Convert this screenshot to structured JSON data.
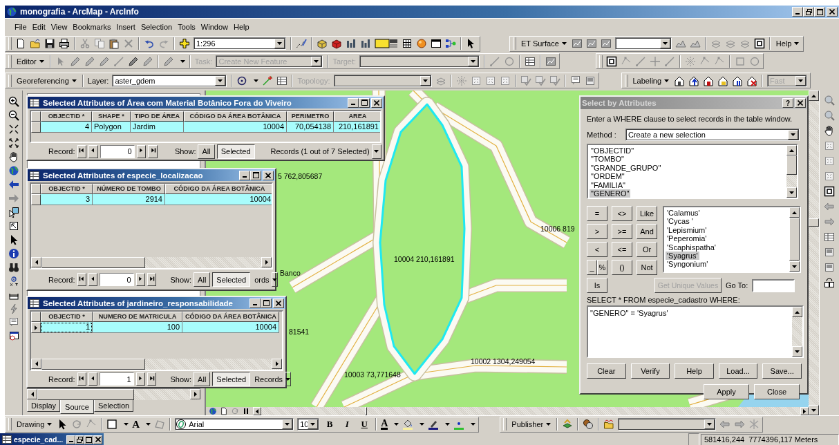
{
  "window": {
    "title": "monografia - ArcMap - ArcInfo"
  },
  "menu": [
    "File",
    "Edit",
    "View",
    "Bookmarks",
    "Insert",
    "Selection",
    "Tools",
    "Window",
    "Help"
  ],
  "standard_toolbar": {
    "scale": "1:296"
  },
  "et_toolbar": {
    "menu": "ET Surface",
    "help_menu": "Help"
  },
  "editor_toolbar": {
    "menu": "Editor",
    "task_label": "Task:",
    "task": "Create New Feature",
    "target_label": "Target:",
    "disabled": true
  },
  "georeferencing_toolbar": {
    "menu": "Georeferencing",
    "layer_label": "Layer:",
    "layer": "aster_gdem"
  },
  "topology_toolbar": {
    "label": "Topology:",
    "disabled": true
  },
  "labeling_toolbar": {
    "menu": "Labeling",
    "mode": "Fast",
    "disabled": true
  },
  "table_windows": [
    {
      "title": "Selected Attributes of Área com Material Botânico Fora do Viveiro",
      "columns": [
        "OBJECTID *",
        "SHAPE *",
        "TIPO DE ÁREA",
        "CÓDIGO DA ÁREA BOTÂNICA",
        "PERIMETRO",
        "AREA"
      ],
      "rows": [
        {
          "cells": [
            "4",
            "Polygon",
            "Jardim",
            "10004",
            "70,054138",
            "210,161891"
          ],
          "selected": true,
          "current": false
        }
      ],
      "record_label": "Record:",
      "record": "0",
      "show_label": "Show:",
      "show": [
        {
          "label": "All",
          "selected": false
        },
        {
          "label": "Selected",
          "selected": true
        }
      ],
      "records_text": "Records (1 out of 7 Selected)"
    },
    {
      "title": "Selected Attributes of especie_localizacao",
      "columns": [
        "OBJECTID *",
        "NÚMERO DE TOMBO",
        "CÓDIGO DA ÁREA BOTÂNICA"
      ],
      "rows": [
        {
          "cells": [
            "3",
            "2914",
            "10004"
          ],
          "selected": true,
          "current": false
        }
      ],
      "record_label": "Record:",
      "record": "0",
      "show_label": "Show:",
      "show": [
        {
          "label": "All",
          "selected": false
        },
        {
          "label": "Selected",
          "selected": true
        }
      ],
      "records_text": "ords"
    },
    {
      "title": "Selected Attributes of jardineiro_responsabilidade",
      "columns": [
        "OBJECTID *",
        "NUMERO DE MATRICULA",
        "CÓDIGO DA ÁREA BOTÂNICA"
      ],
      "rows": [
        {
          "cells": [
            "1",
            "100",
            "10004"
          ],
          "selected": true,
          "current": true
        }
      ],
      "record_label": "Record:",
      "record": "1",
      "show_label": "Show:",
      "show": [
        {
          "label": "All",
          "selected": false
        },
        {
          "label": "Selected",
          "selected": true
        }
      ],
      "records_text": "Records"
    }
  ],
  "toc": {
    "tabs": [
      {
        "label": "Display",
        "selected": false
      },
      {
        "label": "Source",
        "selected": true
      },
      {
        "label": "Selection",
        "selected": false
      }
    ]
  },
  "map": {
    "labels": [
      "5 762,805687",
      "Banco",
      "81541",
      "10004 210,161891",
      "10006 819",
      "10002 1304,249054",
      "10003 73,771648"
    ]
  },
  "dialog": {
    "title": "Select by Attributes",
    "help_button": "?",
    "instruction": "Enter a WHERE clause to select records in the table window.",
    "method_label": "Method :",
    "method": "Create a new selection",
    "fields": [
      {
        "label": "\"OBJECTID\"",
        "selected": false
      },
      {
        "label": "\"TOMBO\"",
        "selected": false
      },
      {
        "label": "\"GRANDE_GRUPO\"",
        "selected": false
      },
      {
        "label": "\"ORDEM\"",
        "selected": false
      },
      {
        "label": "\"FAMILIA\"",
        "selected": false
      },
      {
        "label": "\"GENERO\"",
        "selected": true
      }
    ],
    "operators": [
      "=",
      "<>",
      "Like",
      ">",
      ">=",
      "And",
      "<",
      "<=",
      "Or",
      "_",
      "%",
      "()",
      "Not",
      "Is"
    ],
    "values": [
      {
        "label": "'Calamus'",
        "selected": false
      },
      {
        "label": "'Cycas '",
        "selected": false
      },
      {
        "label": "'Lepismium'",
        "selected": false
      },
      {
        "label": "'Peperomia'",
        "selected": false
      },
      {
        "label": "'Scaphispatha'",
        "selected": false
      },
      {
        "label": "'Syagrus'",
        "selected": true
      },
      {
        "label": "'Syngonium'",
        "selected": false
      }
    ],
    "unique_values_button": {
      "label": "Get Unique Values",
      "disabled": true
    },
    "goto_label": "Go To:",
    "sql_label": "SELECT * FROM especie_cadastro WHERE:",
    "query": "\"GENERO\" = 'Syagrus'",
    "buttons": [
      "Clear",
      "Verify",
      "Help",
      "Load...",
      "Save..."
    ],
    "footer_buttons": [
      "Apply",
      "Close"
    ]
  },
  "drawing_toolbar": {
    "menu": "Drawing",
    "text_tool": "A",
    "font": "Arial",
    "font_size": "10",
    "format_buttons": [
      {
        "label": "B",
        "kind": "bold"
      },
      {
        "label": "I",
        "kind": "italic"
      },
      {
        "label": "U",
        "kind": "underline"
      }
    ],
    "font_color": "A"
  },
  "publisher_toolbar": {
    "menu": "Publisher"
  },
  "minimized_window": {
    "title": "especie_cad..."
  },
  "status_bar": {
    "coordinates": "581416,244  7774396,117 Meters"
  }
}
